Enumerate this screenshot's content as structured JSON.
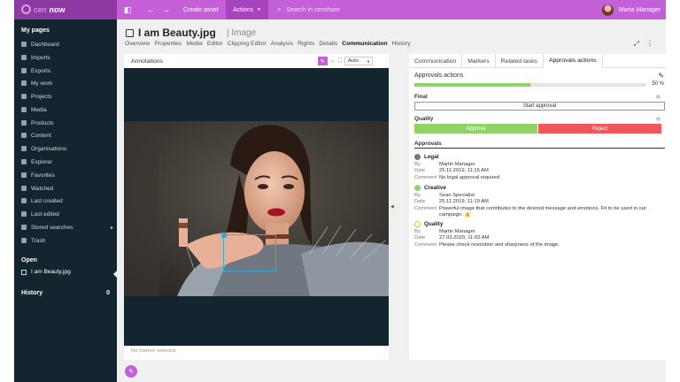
{
  "brand": {
    "logo_prefix": "cen",
    "logo_suffix": "now"
  },
  "topbar": {
    "create_asset": "Create asset",
    "actions": "Actions",
    "search_placeholder": "Search in censhare",
    "user_name": "Maria Manager"
  },
  "sidebar": {
    "my_pages": "My pages",
    "items": [
      {
        "label": "Dashboard",
        "icon": "dashboard-icon"
      },
      {
        "label": "Imports",
        "icon": "import-icon"
      },
      {
        "label": "Exports",
        "icon": "export-icon"
      },
      {
        "label": "My work",
        "icon": "work-icon"
      },
      {
        "label": "Projects",
        "icon": "projects-icon"
      },
      {
        "label": "Media",
        "icon": "media-icon"
      },
      {
        "label": "Products",
        "icon": "products-icon"
      },
      {
        "label": "Content",
        "icon": "content-icon"
      },
      {
        "label": "Organisations",
        "icon": "organisations-icon"
      },
      {
        "label": "Explorer",
        "icon": "explorer-icon"
      },
      {
        "label": "Favorites",
        "icon": "star-icon"
      },
      {
        "label": "Watched",
        "icon": "eye-icon"
      },
      {
        "label": "Last created",
        "icon": "created-icon"
      },
      {
        "label": "Last edited",
        "icon": "edited-icon"
      },
      {
        "label": "Stored searches",
        "icon": "search-icon"
      },
      {
        "label": "Trash",
        "icon": "trash-icon"
      }
    ],
    "open_label": "Open",
    "open_item": "I am Beauty.jpg",
    "history_label": "History",
    "history_count": "0"
  },
  "document": {
    "title": "I am Beauty.jpg",
    "type": "| Image",
    "subnav": [
      "Overview",
      "Properties",
      "Media",
      "Editor",
      "Clipping Editor",
      "Analysis",
      "Rights",
      "Details",
      "Communication",
      "History"
    ],
    "active_tab": "Communication"
  },
  "annotations": {
    "title": "Annotations",
    "zoom": "Auto",
    "status": "No marker selected"
  },
  "right_panel": {
    "tabs": [
      "Communication",
      "Markers",
      "Related tasks",
      "Approvals actions"
    ],
    "active_tab": "Approvals actions",
    "title": "Approvals actions",
    "progress": 0.5,
    "progress_label": "50 %",
    "final_label": "Final",
    "start_button": "Start approval",
    "quality_label": "Quality",
    "approve_button": "Approve",
    "reject_button": "Reject",
    "approvals_heading": "Approvals",
    "labels": {
      "by": "By",
      "date": "Date",
      "comment": "Comment"
    },
    "approvals": [
      {
        "title": "Legal",
        "status": "pending",
        "by": "Martin Manager",
        "date": "25.11.2019, 11:15 AM",
        "comment": "No legal approval required."
      },
      {
        "title": "Creative",
        "status": "approved",
        "by": "Sean Specialist",
        "date": "25.11.2019, 11:19 AM",
        "comment": "Powerful image that contributes to the desired message and emotions. Fit to be used in our campaign. 👍"
      },
      {
        "title": "Quality",
        "status": "in-progress",
        "by": "Martin Manager",
        "date": "27.03.2020, 11:02 AM",
        "comment": "Please check resolution and sharpness of the image."
      }
    ]
  },
  "colors": {
    "brand_purple": "#c360d8",
    "sidebar_bg": "#13262f",
    "approve_green": "#8fd366",
    "reject_red": "#f0565b"
  }
}
